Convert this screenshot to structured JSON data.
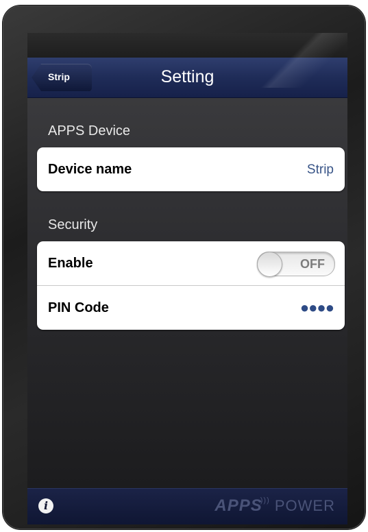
{
  "navbar": {
    "back_label": "Strip",
    "title": "Setting"
  },
  "sections": {
    "device": {
      "header": "APPS Device",
      "device_name_label": "Device name",
      "device_name_value": "Strip"
    },
    "security": {
      "header": "Security",
      "enable_label": "Enable",
      "enable_state": "OFF",
      "pin_label": "PIN Code",
      "pin_value": "●●●●"
    }
  },
  "bottom_bar": {
    "info_icon": "info-icon",
    "brand_apps": "APPS",
    "brand_power": "POWER"
  },
  "colors": {
    "navbar": "#1f2c58",
    "value_text": "#385487",
    "background": "#2b2b2e"
  }
}
